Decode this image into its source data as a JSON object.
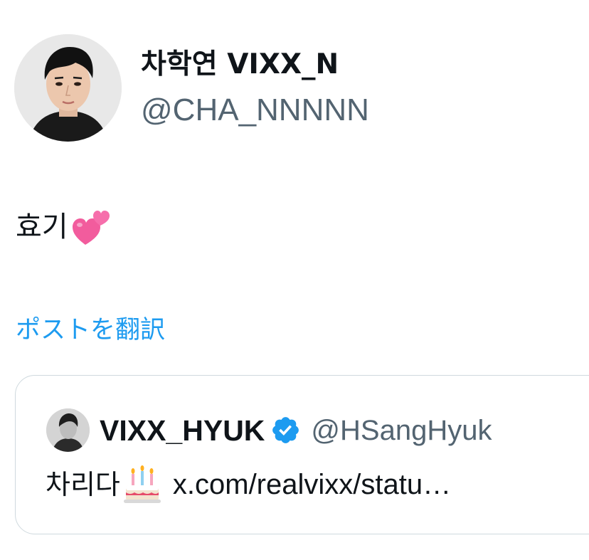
{
  "author": {
    "display_name": "차학연 VIXX_N",
    "handle": "@CHA_NNNNN",
    "avatar_icon": "profile-photo"
  },
  "tweet": {
    "text": "효기",
    "emoji": "two-hearts"
  },
  "translate": {
    "label": "ポストを翻訳"
  },
  "quoted_tweet": {
    "display_name": "VIXX_HYUK",
    "verified": true,
    "handle": "@HSangHyuk",
    "text": "차리다",
    "emoji": "birthday-cake",
    "link": "x.com/realvixx/statu…"
  },
  "colors": {
    "link_blue": "#1d9bf0",
    "secondary_text": "#536471",
    "border": "#cfd9de",
    "verified": "#1d9bf0",
    "heart_pink": "#f25c9d"
  }
}
